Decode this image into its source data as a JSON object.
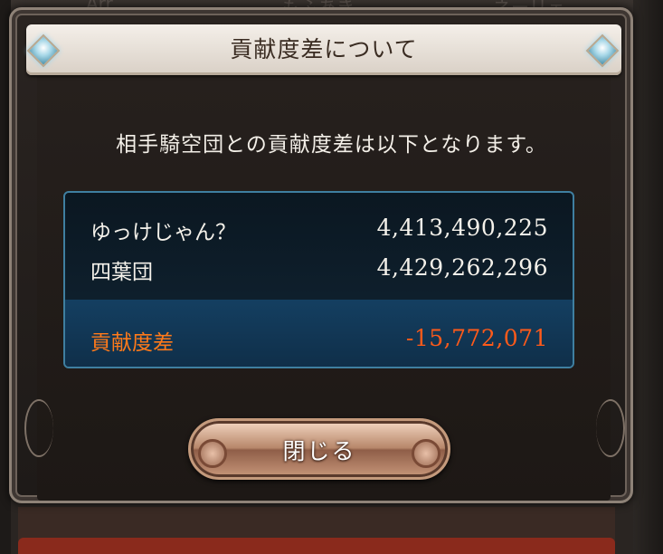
{
  "background": {
    "tabs": [
      "Arr",
      "もふあき",
      "ネーリェ"
    ]
  },
  "dialog": {
    "title": "貢献度差について",
    "message": "相手騎空団との貢献度差は以下となります。"
  },
  "scores": {
    "rows": [
      {
        "name": "ゆっけじゃん？",
        "value": "4,413,490,225"
      },
      {
        "name": "四葉団",
        "value": "4,429,262,296"
      }
    ],
    "difference": {
      "label": "貢献度差",
      "value": "-15,772,071"
    }
  },
  "close_button": {
    "label": "閉じる"
  },
  "colors": {
    "accent_orange": "#ff5a1a",
    "panel_border": "#3f7fa0",
    "title_bg": "#ede6de"
  },
  "icons": [
    "gem-icon"
  ]
}
